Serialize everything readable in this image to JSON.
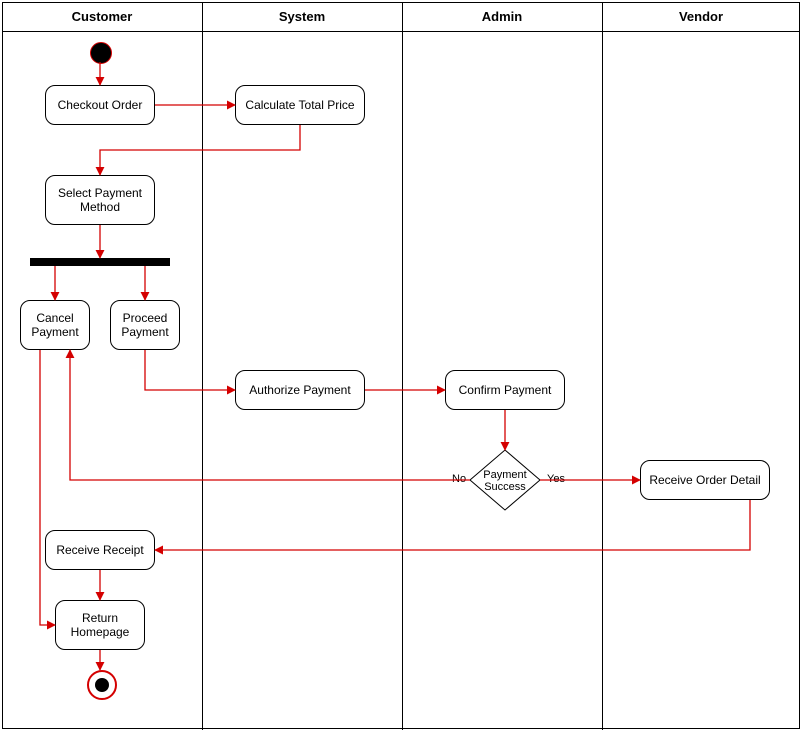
{
  "lanes": {
    "customer": "Customer",
    "system": "System",
    "admin": "Admin",
    "vendor": "Vendor"
  },
  "nodes": {
    "checkout_order": "Checkout Order",
    "calculate_total": "Calculate Total Price",
    "select_payment": "Select Payment Method",
    "cancel_payment": "Cancel Payment",
    "proceed_payment": "Proceed Payment",
    "authorize_payment": "Authorize Payment",
    "confirm_payment": "Confirm Payment",
    "payment_success": "Payment Success",
    "receive_order": "Receive Order Detail",
    "receive_receipt": "Receive Receipt",
    "return_homepage": "Return Homepage"
  },
  "edges": {
    "no": "No",
    "yes": "Yes"
  },
  "chart_data": {
    "type": "activity-diagram",
    "swimlanes": [
      "Customer",
      "System",
      "Admin",
      "Vendor"
    ],
    "initial": "start",
    "final": "end",
    "activities": [
      {
        "id": "checkout_order",
        "label": "Checkout Order",
        "lane": "Customer"
      },
      {
        "id": "calculate_total",
        "label": "Calculate Total Price",
        "lane": "System"
      },
      {
        "id": "select_payment",
        "label": "Select Payment Method",
        "lane": "Customer"
      },
      {
        "id": "fork1",
        "kind": "fork",
        "lane": "Customer"
      },
      {
        "id": "cancel_payment",
        "label": "Cancel Payment",
        "lane": "Customer"
      },
      {
        "id": "proceed_payment",
        "label": "Proceed Payment",
        "lane": "Customer"
      },
      {
        "id": "authorize_payment",
        "label": "Authorize Payment",
        "lane": "System"
      },
      {
        "id": "confirm_payment",
        "label": "Confirm Payment",
        "lane": "Admin"
      },
      {
        "id": "payment_success",
        "label": "Payment Success",
        "kind": "decision",
        "lane": "Admin"
      },
      {
        "id": "receive_order",
        "label": "Receive Order Detail",
        "lane": "Vendor"
      },
      {
        "id": "receive_receipt",
        "label": "Receive Receipt",
        "lane": "Customer"
      },
      {
        "id": "return_homepage",
        "label": "Return Homepage",
        "lane": "Customer"
      }
    ],
    "transitions": [
      {
        "from": "start",
        "to": "checkout_order"
      },
      {
        "from": "checkout_order",
        "to": "calculate_total"
      },
      {
        "from": "calculate_total",
        "to": "select_payment"
      },
      {
        "from": "select_payment",
        "to": "fork1"
      },
      {
        "from": "fork1",
        "to": "cancel_payment"
      },
      {
        "from": "fork1",
        "to": "proceed_payment"
      },
      {
        "from": "proceed_payment",
        "to": "authorize_payment"
      },
      {
        "from": "authorize_payment",
        "to": "confirm_payment"
      },
      {
        "from": "confirm_payment",
        "to": "payment_success"
      },
      {
        "from": "payment_success",
        "to": "cancel_payment",
        "guard": "No"
      },
      {
        "from": "payment_success",
        "to": "receive_order",
        "guard": "Yes"
      },
      {
        "from": "receive_order",
        "to": "receive_receipt"
      },
      {
        "from": "receive_receipt",
        "to": "return_homepage"
      },
      {
        "from": "cancel_payment",
        "to": "return_homepage"
      },
      {
        "from": "return_homepage",
        "to": "end"
      }
    ]
  }
}
